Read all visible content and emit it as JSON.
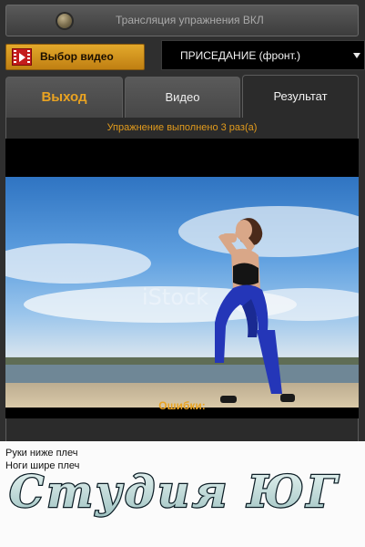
{
  "broadcast": {
    "label": "Трансляция упражнения ВКЛ"
  },
  "toolbar": {
    "select_video_label": "Выбор видео",
    "exercise_value": "ПРИСЕДАНИЕ  (фронт.)"
  },
  "tabs": [
    {
      "label": "Выход"
    },
    {
      "label": "Видео"
    },
    {
      "label": "Результат"
    }
  ],
  "result": {
    "status": "Упражнение выполнено 3 раз(а)",
    "video_watermark": "iStock",
    "errors_label": "Ошибки:",
    "errors": [
      "Руки ниже плеч",
      "Ноги шире плеч"
    ]
  },
  "logo": {
    "text": "Студия ЮГ"
  },
  "colors": {
    "accent": "#e9a322",
    "button": "#d6961f",
    "panel": "#2f2f2f"
  }
}
